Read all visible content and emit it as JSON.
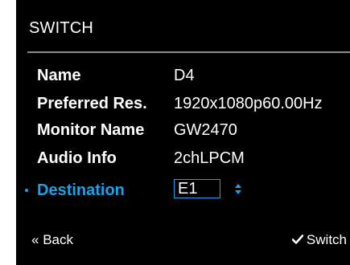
{
  "header": {
    "title": "SWITCH"
  },
  "fields": {
    "name_label": "Name",
    "name_value": "D4",
    "preferred_res_label": "Preferred Res.",
    "preferred_res_value": "1920x1080p60.00Hz",
    "monitor_name_label": "Monitor Name",
    "monitor_name_value": "GW2470",
    "audio_info_label": "Audio Info",
    "audio_info_value": "2chLPCM",
    "destination_label": "Destination",
    "destination_value": "E1"
  },
  "footer": {
    "back_prefix": "«",
    "back_label": "Back",
    "switch_label": "Switch"
  },
  "icons": {
    "back": "double-chevron-left-icon",
    "switch": "check-icon",
    "stepper": "up-down-stepper-icon",
    "bullet": "selection-dot-icon"
  },
  "colors": {
    "background": "#000000",
    "text": "#ffffff",
    "accent": "#1aa3e8",
    "divider": "#8c8c8c"
  }
}
